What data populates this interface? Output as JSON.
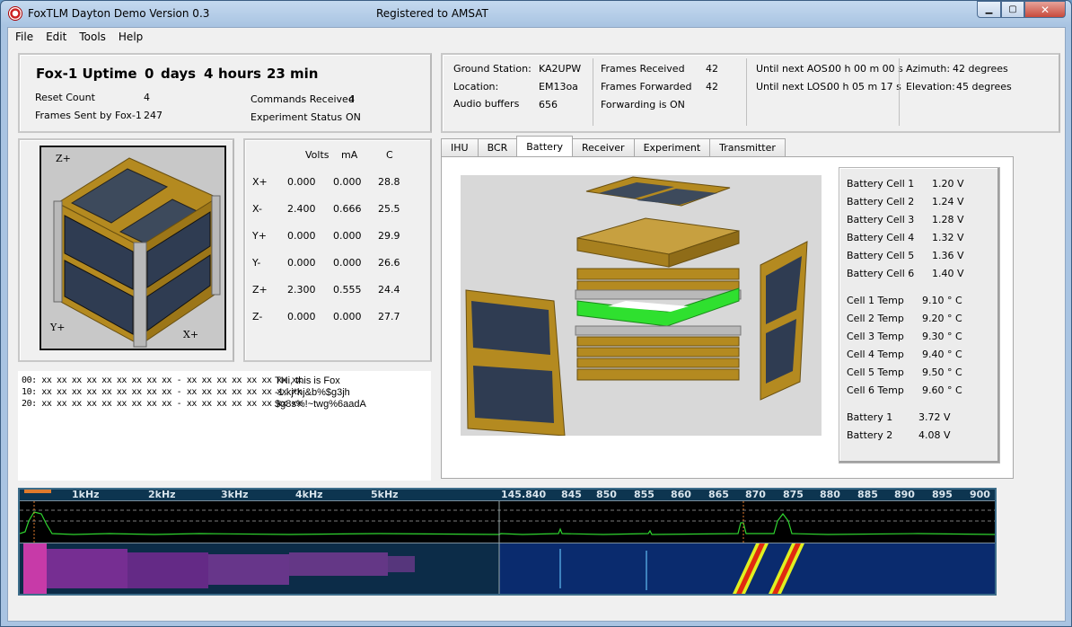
{
  "window": {
    "title": "FoxTLM Dayton Demo Version 0.3",
    "registration": "Registered to AMSAT",
    "minimize_label": "▁",
    "maximize_label": "▢",
    "close_label": "✕"
  },
  "menu": [
    "File",
    "Edit",
    "Tools",
    "Help"
  ],
  "status": {
    "uptime_label": "Fox-1 Uptime",
    "uptime_days_value": "0",
    "uptime_days_unit": "days",
    "uptime_hours_value": "4",
    "uptime_hours_unit": "hours",
    "uptime_min_value": "23",
    "uptime_min_unit": "min",
    "reset_count_label": "Reset Count",
    "reset_count_value": "4",
    "frames_sent_label": "Frames Sent by Fox-1",
    "frames_sent_value": "247",
    "commands_received_label": "Commands Received",
    "commands_received_value": "4",
    "experiment_status_label": "Experiment Status",
    "experiment_status_value": "ON"
  },
  "station": {
    "ground_station_label": "Ground Station:",
    "ground_station_value": "KA2UPW",
    "location_label": "Location:",
    "location_value": "EM13oa",
    "audio_buffers_label": "Audio buffers",
    "audio_buffers_value": "656",
    "frames_received_label": "Frames Received",
    "frames_received_value": "42",
    "frames_forwarded_label": "Frames Forwarded",
    "frames_forwarded_value": "42",
    "forwarding_text": "Forwarding is  ON",
    "aos_label": "Until next AOS:",
    "aos_value": "00 h 00 m 00 s",
    "los_label": "Until next LOS:",
    "los_value": "00 h 05 m 17 s",
    "azimuth_label": "Azimuth:",
    "azimuth_value": "42  degrees",
    "elevation_label": "Elevation:",
    "elevation_value": "45  degrees"
  },
  "cube_labels": {
    "z": "Z+",
    "y": "Y+",
    "x": "X+"
  },
  "solar_table": {
    "headers": [
      "Volts",
      "mA",
      "C"
    ],
    "rows": [
      {
        "panel": "X+",
        "volts": "0.000",
        "ma": "0.000",
        "c": "28.8"
      },
      {
        "panel": "X-",
        "volts": "2.400",
        "ma": "0.666",
        "c": "25.5"
      },
      {
        "panel": "Y+",
        "volts": "0.000",
        "ma": "0.000",
        "c": "29.9"
      },
      {
        "panel": "Y-",
        "volts": "0.000",
        "ma": "0.000",
        "c": "26.6"
      },
      {
        "panel": "Z+",
        "volts": "2.300",
        "ma": "0.555",
        "c": "24.4"
      },
      {
        "panel": "Z-",
        "volts": "0.000",
        "ma": "0.000",
        "c": "27.7"
      }
    ]
  },
  "hex_dump": [
    {
      "offset": "00: xx xx xx xx xx xx xx xx xx - xx xx xx xx xx xx xx xx",
      "ascii": "THi, this is Fox"
    },
    {
      "offset": "10: xx xx xx xx xx xx xx xx xx - xx xx xx xx xx xx xx xx",
      "ascii": "-1.kj*hj&b%$g3jh"
    },
    {
      "offset": "20: xx xx xx xx xx xx xx xx xx - xx xx xx xx xx xx xx xx",
      "ascii": "$g8s%!~twg%6aadA"
    }
  ],
  "tabs": [
    "IHU",
    "BCR",
    "Battery",
    "Receiver",
    "Experiment",
    "Transmitter"
  ],
  "active_tab": "Battery",
  "battery": {
    "cells": [
      {
        "label": "Battery Cell 1",
        "value": "1.20 V"
      },
      {
        "label": "Battery Cell 2",
        "value": "1.24 V"
      },
      {
        "label": "Battery Cell 3",
        "value": "1.28 V"
      },
      {
        "label": "Battery Cell 4",
        "value": "1.32 V"
      },
      {
        "label": "Battery Cell 5",
        "value": "1.36 V"
      },
      {
        "label": "Battery Cell 6",
        "value": "1.40 V"
      }
    ],
    "temps": [
      {
        "label": "Cell 1 Temp",
        "value": "9.10 ° C"
      },
      {
        "label": "Cell 2 Temp",
        "value": "9.20 ° C"
      },
      {
        "label": "Cell 3 Temp",
        "value": "9.30 ° C"
      },
      {
        "label": "Cell 4 Temp",
        "value": "9.40 ° C"
      },
      {
        "label": "Cell 5 Temp",
        "value": "9.50 ° C"
      },
      {
        "label": "Cell 6 Temp",
        "value": "9.60 ° C"
      }
    ],
    "packs": [
      {
        "label": "Battery 1",
        "value": "3.72 V"
      },
      {
        "label": "Battery 2",
        "value": "4.08 V"
      }
    ]
  },
  "spectrum": {
    "audio_scale": [
      "1kHz",
      "2kHz",
      "3kHz",
      "4kHz",
      "5kHz"
    ],
    "rf_scale": [
      "145.840",
      "845",
      "850",
      "855",
      "860",
      "865",
      "870",
      "875",
      "880",
      "885",
      "890",
      "895",
      "900"
    ]
  },
  "colors": {
    "trace": "#2fd42f",
    "waterfall_bg": "#0a2b6e",
    "signal_hot": "#e0f020",
    "panel_green": "#2fe02f",
    "panel_gold": "#b48a20"
  }
}
